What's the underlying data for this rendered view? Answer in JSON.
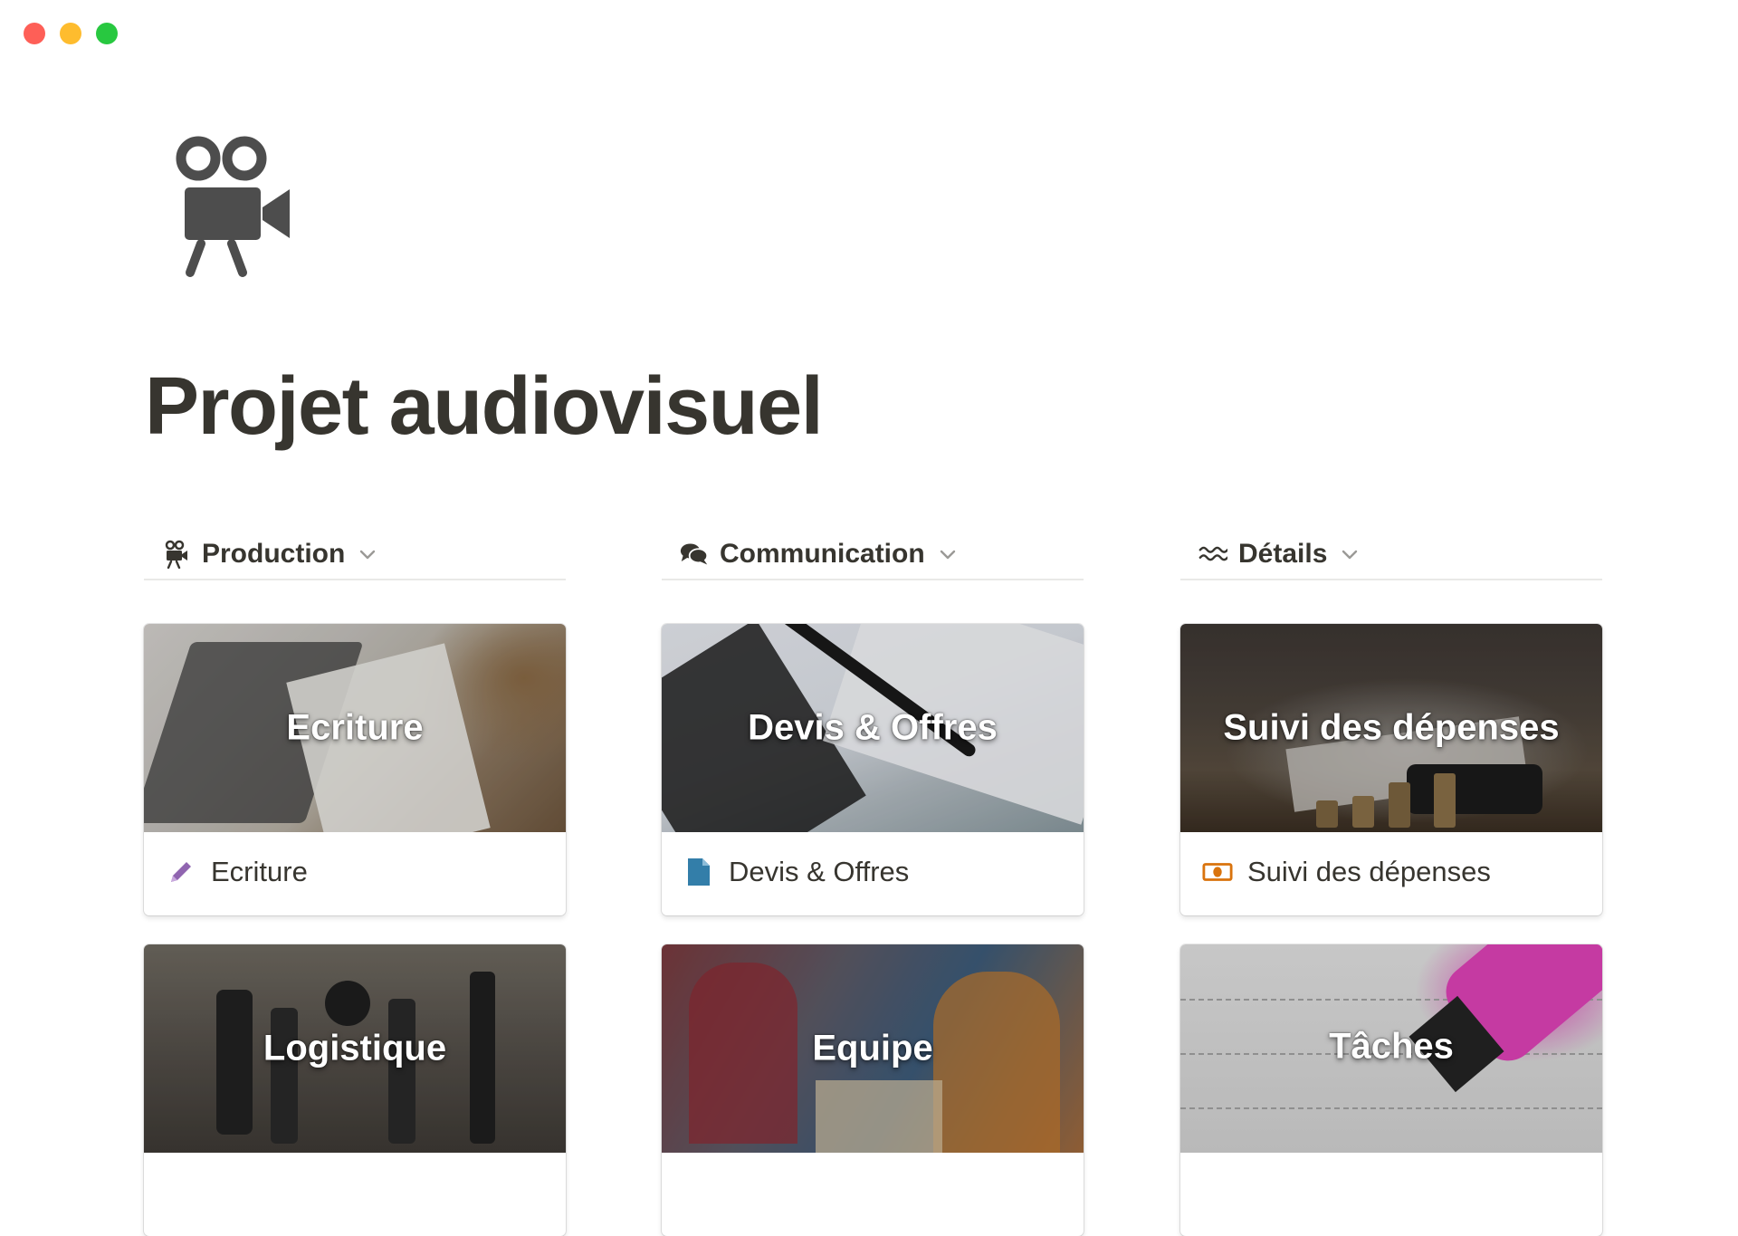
{
  "window": {
    "controls": [
      "close",
      "minimize",
      "zoom"
    ]
  },
  "page": {
    "icon": "movie-camera-icon",
    "title": "Projet audiovisuel"
  },
  "columns": [
    {
      "title": "Production",
      "icon": "movie-camera-icon",
      "cards": [
        {
          "cover_text": "Ecriture",
          "label": "Ecriture",
          "icon": "pencil-icon"
        },
        {
          "cover_text": "Logistique",
          "label": "",
          "icon": ""
        }
      ]
    },
    {
      "title": "Communication",
      "icon": "speech-bubbles-icon",
      "cards": [
        {
          "cover_text": "Devis & Offres",
          "label": "Devis & Offres",
          "icon": "document-icon"
        },
        {
          "cover_text": "Equipe",
          "label": "",
          "icon": ""
        }
      ]
    },
    {
      "title": "Détails",
      "icon": "wave-lines-icon",
      "cards": [
        {
          "cover_text": "Suivi des dépenses",
          "label": "Suivi des dépenses",
          "icon": "banknote-icon"
        },
        {
          "cover_text": "Tâches",
          "label": "",
          "icon": ""
        }
      ]
    }
  ],
  "colors": {
    "text": "#37352f",
    "pencil": "#9065b0",
    "document": "#337ea9",
    "banknote": "#d9730d",
    "divider": "#e9e9e7"
  }
}
